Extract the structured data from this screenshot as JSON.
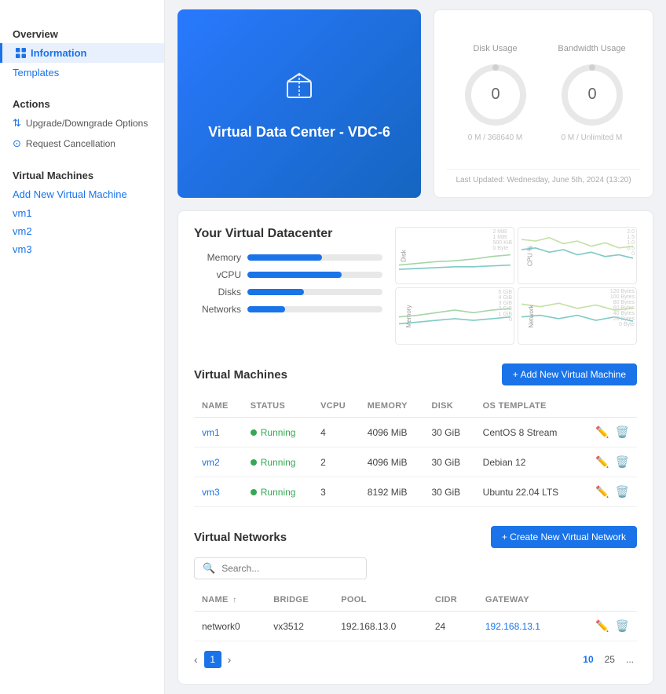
{
  "sidebar": {
    "overview_label": "Overview",
    "information_label": "Information",
    "templates_label": "Templates",
    "actions_label": "Actions",
    "upgrade_label": "Upgrade/Downgrade Options",
    "cancel_label": "Request Cancellation",
    "virtual_machines_label": "Virtual Machines",
    "add_vm_label": "Add New Virtual Machine",
    "vm1_label": "vm1",
    "vm2_label": "vm2",
    "vm3_label": "vm3"
  },
  "hero": {
    "title": "Virtual Data Center - VDC-6"
  },
  "usage": {
    "disk_label": "Disk Usage",
    "bandwidth_label": "Bandwidth Usage",
    "disk_value": "0",
    "bandwidth_value": "0",
    "disk_sub": "0 M / 368640 M",
    "bandwidth_sub": "0 M / Unlimited M",
    "last_updated": "Last Updated: Wednesday, June 5th, 2024 (13:20)"
  },
  "dc": {
    "title": "Your Virtual Datacenter",
    "stats": [
      {
        "label": "Memory",
        "pct": 55
      },
      {
        "label": "vCPU",
        "pct": 70
      },
      {
        "label": "Disks",
        "pct": 42
      },
      {
        "label": "Networks",
        "pct": 28
      }
    ],
    "charts": [
      {
        "ylabel": "Disk",
        "title": "2 MiB\n1 MiB\n500 KiB\n0 Byte"
      },
      {
        "ylabel": "CPU %",
        "title": "2.0\n1.5\n1.0\n0.5\n0"
      },
      {
        "ylabel": "Memory",
        "title": "5 GiB\n4 GiB\n3 GiB\n2 GiB\n1 GiB\n0 Byte"
      },
      {
        "ylabel": "Network",
        "title": "120 Bytes\n100 Bytes\n80 Bytes\n60 Bytes\n40 Bytes\n20 Bytes\n0 Byte"
      }
    ]
  },
  "vms": {
    "section_label": "Virtual Machines",
    "add_btn": "+ Add New Virtual Machine",
    "columns": [
      "NAME",
      "STATUS",
      "VCPU",
      "MEMORY",
      "DISK",
      "OS TEMPLATE"
    ],
    "rows": [
      {
        "name": "vm1",
        "status": "Running",
        "vcpu": "4",
        "memory": "4096 MiB",
        "disk": "30 GiB",
        "os": "CentOS 8 Stream"
      },
      {
        "name": "vm2",
        "status": "Running",
        "vcpu": "2",
        "memory": "4096 MiB",
        "disk": "30 GiB",
        "os": "Debian 12"
      },
      {
        "name": "vm3",
        "status": "Running",
        "vcpu": "3",
        "memory": "8192 MiB",
        "disk": "30 GiB",
        "os": "Ubuntu 22.04 LTS"
      }
    ]
  },
  "networks": {
    "section_label": "Virtual Networks",
    "search_placeholder": "Search...",
    "add_btn": "+ Create New Virtual Network",
    "columns": [
      "NAME",
      "BRIDGE",
      "POOL",
      "CIDR",
      "GATEWAY"
    ],
    "rows": [
      {
        "name": "network0",
        "bridge": "vx3512",
        "pool": "192.168.13.0",
        "cidr": "24",
        "gateway": "192.168.13.1"
      }
    ],
    "pagination": {
      "prev": "‹",
      "next": "›",
      "page": "1",
      "sizes": [
        "10",
        "25",
        "..."
      ]
    }
  }
}
